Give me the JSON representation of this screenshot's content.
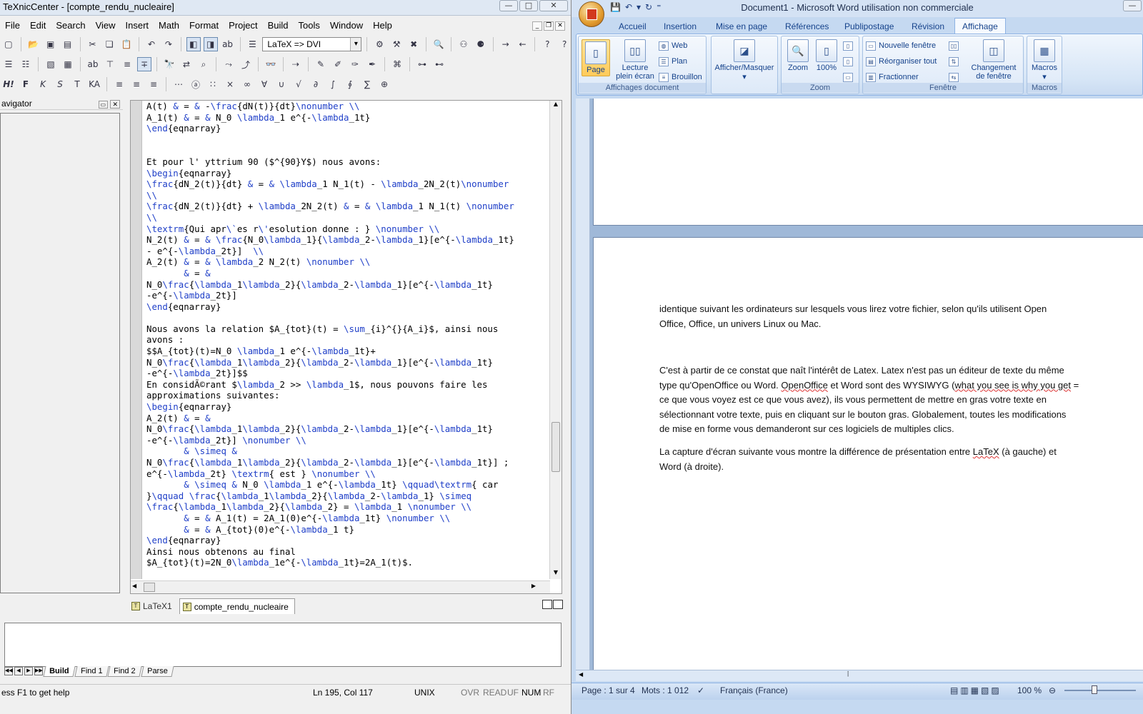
{
  "texniccenter": {
    "title": "TeXnicCenter - [compte_rendu_nucleaire]",
    "window_buttons": [
      "—",
      "□",
      "✕"
    ],
    "menu": [
      "File",
      "Edit",
      "Search",
      "View",
      "Insert",
      "Math",
      "Format",
      "Project",
      "Build",
      "Tools",
      "Window",
      "Help"
    ],
    "profile_combo": "LaTeX => DVI",
    "navigator_label": "avigator",
    "code_lines": [
      "A(t) & = & -\\frac{dN(t)}{dt}\\nonumber \\\\",
      "A_1(t) & = & N_0 \\lambda_1 e^{-\\lambda_1t}",
      "\\end{eqnarray}",
      "",
      "",
      "Et pour l' yttrium 90 ($^{90}Y$) nous avons:",
      "\\begin{eqnarray}",
      "\\frac{dN_2(t)}{dt} & = & \\lambda_1 N_1(t) - \\lambda_2N_2(t)\\nonumber",
      "\\\\",
      "\\frac{dN_2(t)}{dt} + \\lambda_2N_2(t) & = & \\lambda_1 N_1(t) \\nonumber",
      "\\\\",
      "\\textrm{Qui apr\\`es r\\'esolution donne : } \\nonumber \\\\",
      "N_2(t) & = & \\frac{N_0\\lambda_1}{\\lambda_2-\\lambda_1}[e^{-\\lambda_1t}",
      "- e^{-\\lambda_2t}]  \\\\",
      "A_2(t) & = & \\lambda_2 N_2(t) \\nonumber \\\\",
      "       & = &",
      "N_0\\frac{\\lambda_1\\lambda_2}{\\lambda_2-\\lambda_1}[e^{-\\lambda_1t}",
      "-e^{-\\lambda_2t}]",
      "\\end{eqnarray}",
      "",
      "Nous avons la relation $A_{tot}(t) = \\sum_{i}^{}{A_i}$, ainsi nous",
      "avons :",
      "$$A_{tot}(t)=N_0 \\lambda_1 e^{-\\lambda_1t}+",
      "N_0\\frac{\\lambda_1\\lambda_2}{\\lambda_2-\\lambda_1}[e^{-\\lambda_1t}",
      "-e^{-\\lambda_2t}]$$",
      "En considÃ©rant $\\lambda_2 >> \\lambda_1$, nous pouvons faire les",
      "approximations suivantes:",
      "\\begin{eqnarray}",
      "A_2(t) & = &",
      "N_0\\frac{\\lambda_1\\lambda_2}{\\lambda_2-\\lambda_1}[e^{-\\lambda_1t}",
      "-e^{-\\lambda_2t}] \\nonumber \\\\",
      "       & \\simeq &",
      "N_0\\frac{\\lambda_1\\lambda_2}{\\lambda_2-\\lambda_1}[e^{-\\lambda_1t}] ;",
      "e^{-\\lambda_2t} \\textrm{ est } \\nonumber \\\\",
      "       & \\simeq & N_0 \\lambda_1 e^{-\\lambda_1t} \\qquad\\textrm{ car",
      "}\\qquad \\frac{\\lambda_1\\lambda_2}{\\lambda_2-\\lambda_1} \\simeq",
      "\\frac{\\lambda_1\\lambda_2}{\\lambda_2} = \\lambda_1 \\nonumber \\\\",
      "       & = & A_1(t) = 2A_1(0)e^{-\\lambda_1t} \\nonumber \\\\",
      "       & = & A_{tot}(0)e^{-\\lambda_1 t}",
      "\\end{eqnarray}",
      "Ainsi nous obtenons au final",
      "$A_{tot}(t)=2N_0\\lambda_1e^{-\\lambda_1t}=2A_1(t)$."
    ],
    "doc_tabs": [
      "LaTeX1",
      "compte_rendu_nucleaire"
    ],
    "output_tabs": [
      "Build",
      "Find 1",
      "Find 2",
      "Parse"
    ],
    "status": {
      "help": "ess F1 to get help",
      "position": "Ln 195, Col 117",
      "format": "UNIX",
      "flags": [
        "OVR",
        "READ",
        "UF",
        "NUM",
        "RF"
      ]
    }
  },
  "word": {
    "title": "Document1 - Microsoft Word utilisation non commerciale",
    "ribbon_tabs": [
      "Accueil",
      "Insertion",
      "Mise en page",
      "Références",
      "Publipostage",
      "Révision",
      "Affichage"
    ],
    "active_tab": "Affichage",
    "groups": {
      "affichages_document": {
        "label": "Affichages document",
        "page_label": "Page",
        "lecture_label_1": "Lecture",
        "lecture_label_2": "plein écran",
        "web": "Web",
        "plan": "Plan",
        "brouillon": "Brouillon"
      },
      "afficher_masquer": {
        "label": "Afficher/Masquer"
      },
      "zoom": {
        "label": "Zoom",
        "zoom_btn": "Zoom",
        "pct_btn": "100%"
      },
      "fenetre": {
        "label": "Fenêtre",
        "nouvelle": "Nouvelle fenêtre",
        "reorganiser": "Réorganiser tout",
        "fractionner": "Fractionner",
        "changement_1": "Changement",
        "changement_2": "de fenêtre"
      },
      "macros": {
        "label": "Macros",
        "btn": "Macros"
      }
    },
    "paragraphs": {
      "p1a": "identique suivant les ordinateurs sur lesquels vous lirez votre fichier, selon qu'ils utilisent Open",
      "p1b": "Office, Office, un univers Linux ou Mac.",
      "p2a": "C'est à partir de ce constat que naît l'intérêt de Latex. Latex n'est pas un éditeur de texte du même",
      "p2b_pre": "type qu'OpenOffice ou Word. ",
      "p2b_sq1": "OpenOffice",
      "p2b_mid": " et Word sont des WYSIWYG (",
      "p2b_sq2": "what you see is why you get",
      "p2b_post": " =",
      "p2c": "ce que vous voyez  est ce que vous avez), ils vous permettent de mettre en gras votre texte en",
      "p2d": "sélectionnant votre texte, puis en cliquant sur le bouton gras. Globalement, toutes les modifications",
      "p2e": "de mise en forme vous demanderont sur ces logiciels de multiples clics.",
      "p3a_pre": "La capture d'écran suivante vous montre la différence de présentation entre ",
      "p3a_sq": "LaTeX",
      "p3a_post": " (à gauche) et",
      "p3b": "Word (à droite)."
    },
    "status": {
      "page": "Page : 1 sur 4",
      "words": "Mots : 1 012",
      "language": "Français (France)",
      "zoom": "100 %"
    }
  }
}
